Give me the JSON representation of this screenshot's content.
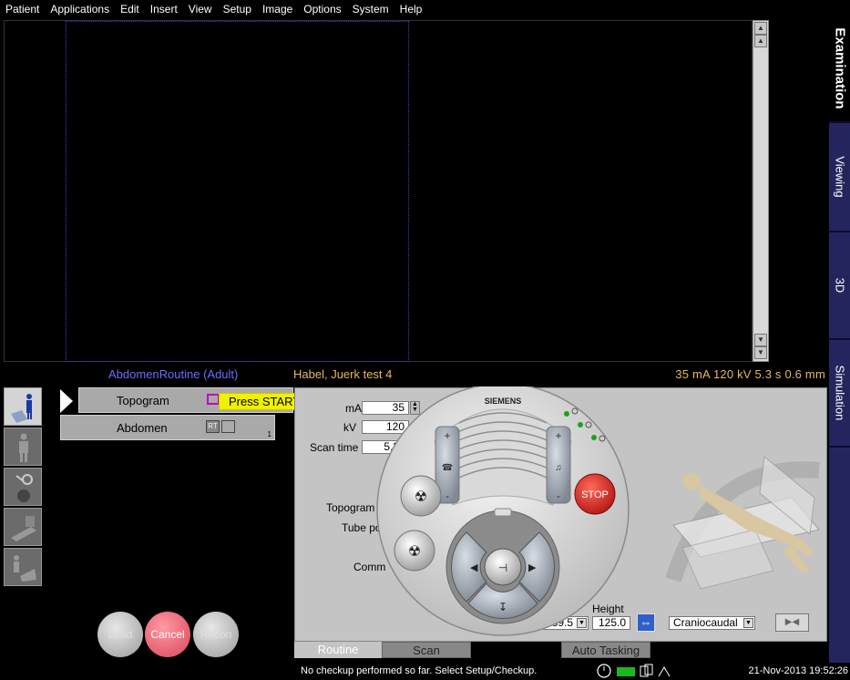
{
  "menu": [
    "Patient",
    "Applications",
    "Edit",
    "Insert",
    "View",
    "Setup",
    "Image",
    "Options",
    "System",
    "Help"
  ],
  "side_tabs": [
    "Examination",
    "Viewing",
    "3D",
    "Simulation"
  ],
  "info": {
    "protocol": "AbdomenRoutine (Adult)",
    "patient": "Habel, Juerk test 4",
    "params": "35 mA  120 kV  5.3 s  0.6 mm"
  },
  "protocol_list": {
    "items": [
      {
        "label": "Topogram"
      },
      {
        "label": "Abdomen",
        "badge": "RT",
        "index": "1"
      }
    ],
    "tooltip": "Press START"
  },
  "buttons": {
    "load": "Load",
    "cancel": "Cancel",
    "recon": "Recon"
  },
  "params": {
    "ma_label": "mA",
    "ma_value": "35",
    "kv_label": "kV",
    "kv_value": "120",
    "scan_time_label": "Scan time",
    "scan_time_value": "5.3",
    "topogram_label": "Topogram",
    "tube_pos_label": "Tube po",
    "comment_label": "Comm",
    "position_label": "on",
    "position_value": "89.5",
    "height_label": "Height",
    "height_value": "125.0",
    "direction_value": "Craniocaudal"
  },
  "control_pad": {
    "brand": "SIEMENS",
    "stop_label": "STOP",
    "plus": "+",
    "minus": "-"
  },
  "bottom_tabs": [
    "Routine",
    "Scan",
    "Auto Tasking"
  ],
  "status": {
    "message": "No checkup performed so far. Select Setup/Checkup.",
    "datetime": "21-Nov-2013 19:52:26"
  },
  "colors": {
    "protocol_text": "#6d6dff",
    "patient_text": "#e6b85c",
    "tab_bg": "#25255e",
    "stop_red": "#d3231f"
  }
}
